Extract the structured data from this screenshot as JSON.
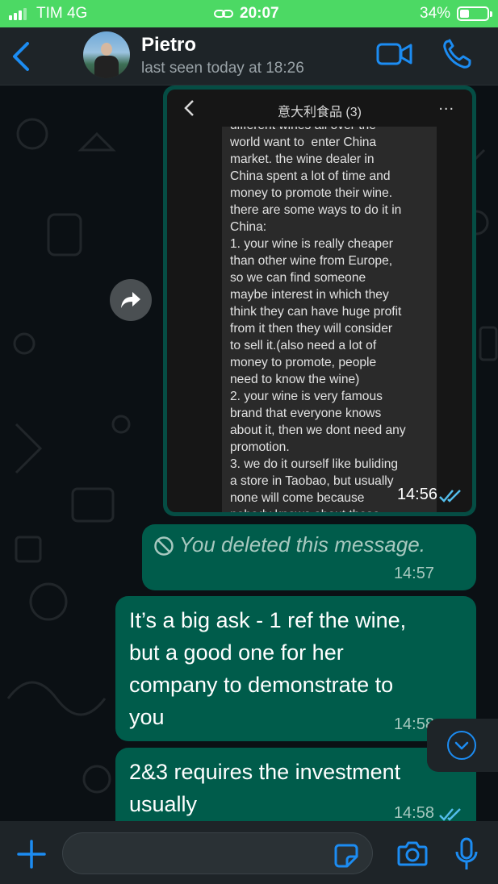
{
  "status_bar": {
    "carrier": "TIM  4G",
    "time": "20:07",
    "battery": "34%"
  },
  "header": {
    "contact_name": "Pietro",
    "last_seen": "last seen today at 18:26"
  },
  "image_message": {
    "shot_title": "意大利食品 (3)",
    "shot_more": "...",
    "shot_text": "different wines all over the\nworld want to  enter China\nmarket. the wine dealer in\nChina spent a lot of time and\nmoney to promote their wine.\nthere are some ways to do it in\nChina:\n1. your wine is really cheaper\nthan other wine from Europe,\nso we can find someone\nmaybe interest in which they\nthink they can have huge profit\nfrom it then they will consider\nto sell it.(also need a lot of\nmoney to promote, people\nneed to know the wine)\n2. your wine is very famous\nbrand that everyone knows\nabout it, then we dont need any\npromotion.\n3. we do it ourself like buliding\na store in Taobao, but usually\nnone will come because\nnobody knows about these",
    "time": "14:56"
  },
  "deleted_message": {
    "text": "You deleted this message.",
    "time": "14:57"
  },
  "messages": [
    {
      "text": "It’s a big ask - 1 ref the wine,\nbut a good one for her\ncompany to demonstrate to\nyou",
      "time": "14:58"
    },
    {
      "text": "2&3 requires the investment\nusually",
      "time": "14:58"
    }
  ],
  "input": {
    "placeholder": ""
  },
  "colors": {
    "status_bar": "#4cd964",
    "outgoing_bubble": "#005c4b",
    "accent_blue": "#1c8cf2",
    "read_ticks": "#53bdeb",
    "header": "#1e2428"
  },
  "icons": [
    "back-icon",
    "video-call-icon",
    "voice-call-icon",
    "forward-icon",
    "blocked-icon",
    "double-check-icon",
    "chevron-down-icon",
    "plus-icon",
    "sticker-icon",
    "camera-icon",
    "microphone-icon"
  ]
}
